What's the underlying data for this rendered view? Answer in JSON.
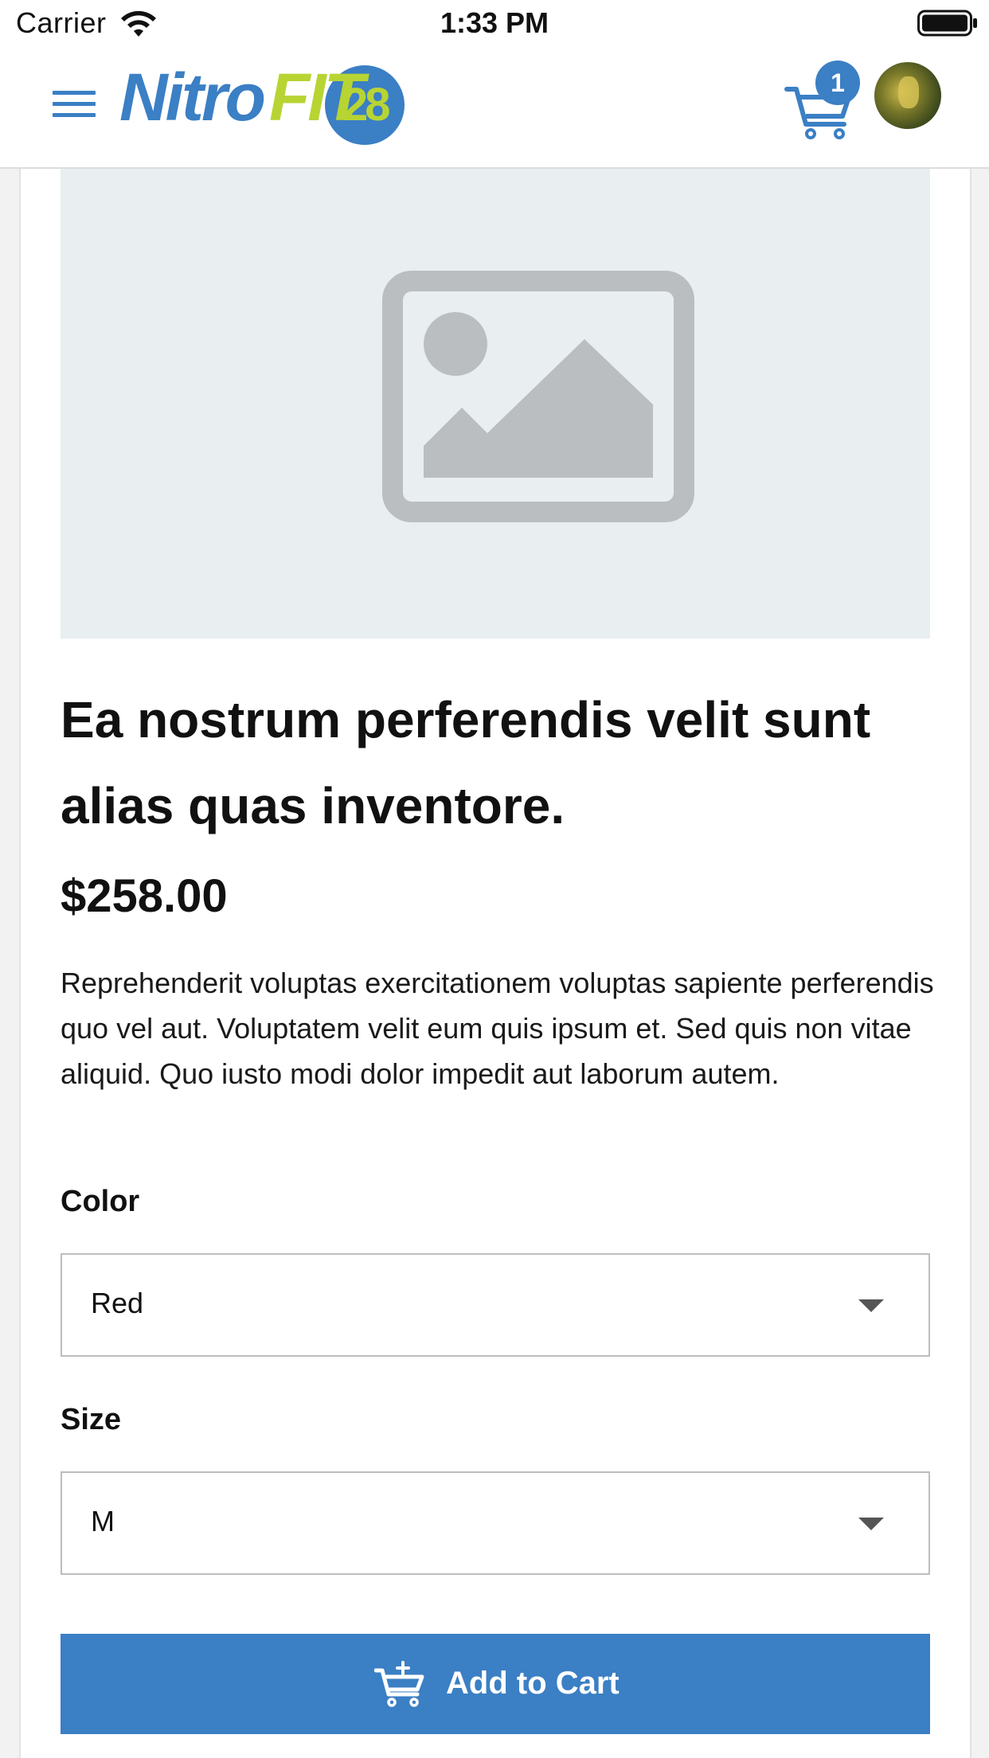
{
  "status_bar": {
    "carrier": "Carrier",
    "time": "1:33 PM",
    "icons": [
      "wifi-icon",
      "battery-icon"
    ]
  },
  "header": {
    "menu_icon": "hamburger-menu-icon",
    "logo": {
      "part1": "Nitro",
      "part2": "FIT",
      "part3": "28"
    },
    "cart": {
      "icon": "shopping-cart-icon",
      "badge_count": "1"
    },
    "avatar": "user-avatar"
  },
  "product": {
    "image_icon": "image-placeholder-icon",
    "title": "Ea nostrum perferendis velit sunt alias quas inventore.",
    "price": "$258.00",
    "description": "Reprehenderit voluptas exercitationem voluptas sapiente perferendis quo vel aut. Voluptatem velit eum quis ipsum et. Sed quis non vitae aliquid. Quo iusto modi dolor impedit aut laborum autem."
  },
  "options": {
    "color": {
      "label": "Color",
      "selected": "Red"
    },
    "size": {
      "label": "Size",
      "selected": "M"
    }
  },
  "actions": {
    "add_to_cart_label": "Add to Cart",
    "add_to_cart_icon": "cart-add-icon"
  },
  "colors": {
    "brand_blue": "#3b7fc4",
    "brand_green": "#b7d433",
    "placeholder_bg": "#e9eef0",
    "placeholder_icon": "#bbbec1"
  }
}
